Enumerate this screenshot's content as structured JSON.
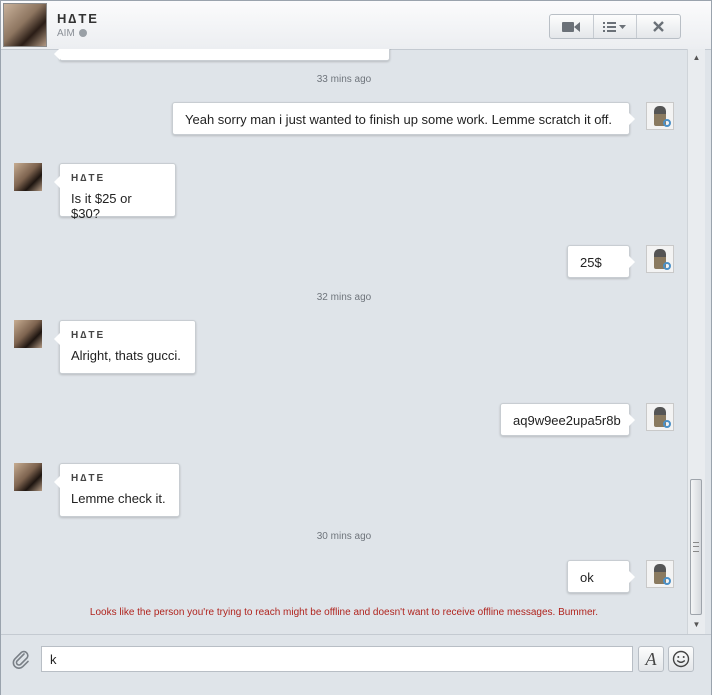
{
  "contact": {
    "name": "H∆TE",
    "service": "AIM"
  },
  "header_buttons": {
    "video_icon": "video-camera-icon",
    "menu_icon": "list-menu-icon",
    "close_icon": "close-icon"
  },
  "messages": [
    {
      "id": "partial",
      "direction": "in",
      "text": ""
    },
    {
      "id": "ts1",
      "type": "timestamp",
      "text": "33 mins ago"
    },
    {
      "id": "m1",
      "direction": "out",
      "text": "Yeah sorry man i just wanted to finish up some work. Lemme scratch it off."
    },
    {
      "id": "m2",
      "direction": "in",
      "sender": "H∆TE",
      "text": "Is it $25 or $30?"
    },
    {
      "id": "m3",
      "direction": "out",
      "text": "25$"
    },
    {
      "id": "ts2",
      "type": "timestamp",
      "text": "32 mins ago"
    },
    {
      "id": "m4",
      "direction": "in",
      "sender": "H∆TE",
      "text": "Alright, thats gucci."
    },
    {
      "id": "m5",
      "direction": "out",
      "text": "aq9w9ee2upa5r8b"
    },
    {
      "id": "m6",
      "direction": "in",
      "sender": "H∆TE",
      "text": "Lemme check it."
    },
    {
      "id": "ts3",
      "type": "timestamp",
      "text": "30 mins ago"
    },
    {
      "id": "m7",
      "direction": "out",
      "text": "ok"
    }
  ],
  "offline_notice": "Looks like the person you're trying to reach might be offline and doesn't want to receive offline messages. Bummer.",
  "composer": {
    "value": "k",
    "font_button_label": "A",
    "emoji_icon": "smiley-icon",
    "attach_icon": "paperclip-icon"
  },
  "colors": {
    "background": "#dfe4e9",
    "notice": "#b0241e"
  }
}
